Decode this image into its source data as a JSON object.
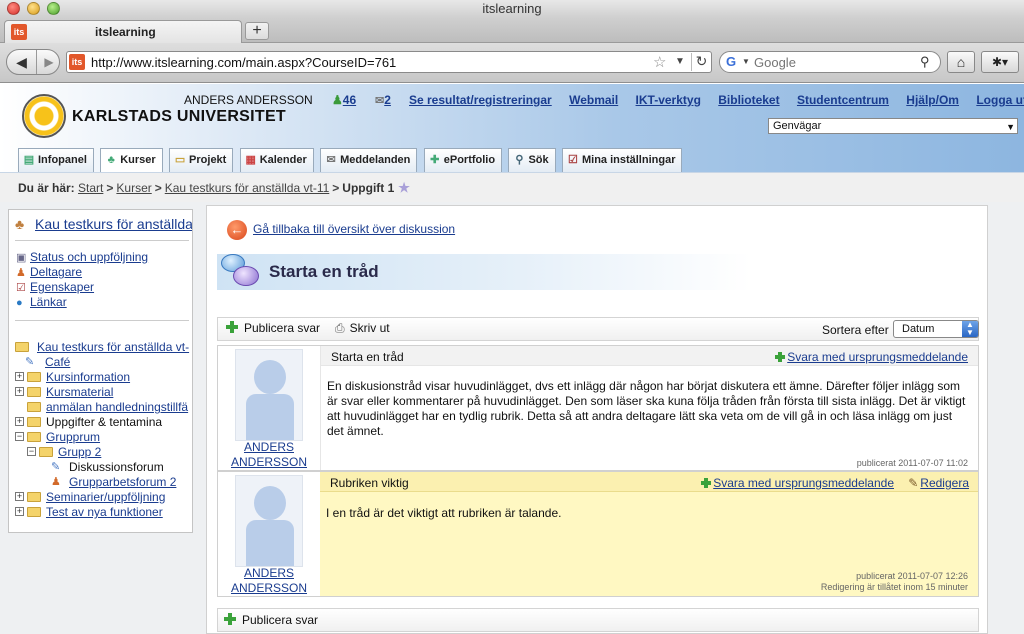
{
  "browser": {
    "window_title": "itslearning",
    "tab_title": "itslearning",
    "favicon_text": "its",
    "new_tab_label": "+",
    "url": "http://www.itslearning.com/main.aspx?CourseID=761",
    "search_placeholder": "Google",
    "icons": [
      "back-arrow-icon",
      "forward-arrow-icon",
      "bookmark-star-icon",
      "reload-icon",
      "search-magnifier-icon",
      "home-icon",
      "bookmarks-icon"
    ]
  },
  "header": {
    "university_name": "KARLSTADS UNIVERSITET",
    "user_name": "ANDERS ANDERSSON",
    "online_count": "46",
    "message_count": "2",
    "links": [
      "Se resultat/registreringar",
      "Webmail",
      "IKT-verktyg",
      "Biblioteket",
      "Studentcentrum",
      "Hjälp/Om",
      "Logga ut"
    ],
    "shortcut_select": "Genvägar"
  },
  "main_tabs": [
    {
      "label": "Infopanel",
      "icon": "infopanel-icon"
    },
    {
      "label": "Kurser",
      "icon": "courses-icon"
    },
    {
      "label": "Projekt",
      "icon": "project-icon"
    },
    {
      "label": "Kalender",
      "icon": "calendar-icon"
    },
    {
      "label": "Meddelanden",
      "icon": "messages-icon"
    },
    {
      "label": "ePortfolio",
      "icon": "eportfolio-icon"
    },
    {
      "label": "Sök",
      "icon": "search-icon"
    },
    {
      "label": "Mina inställningar",
      "icon": "settings-icon"
    }
  ],
  "breadcrumb": {
    "prefix": "Du är här:",
    "items": [
      "Start",
      "Kurser",
      "Kau testkurs för anställda vt-11"
    ],
    "current": "Uppgift 1",
    "separator": ">"
  },
  "sidebar": {
    "course_title": "Kau testkurs för anställda",
    "links": [
      "Status och uppföljning",
      "Deltagare",
      "Egenskaper",
      "Länkar"
    ],
    "tree": [
      {
        "label": "Kau testkurs för anställda vt-",
        "level": 0,
        "type": "folder-open"
      },
      {
        "label": "Café",
        "level": 1,
        "type": "forum"
      },
      {
        "label": "Kursinformation",
        "level": 0,
        "type": "folder-collapsed"
      },
      {
        "label": "Kursmaterial",
        "level": 0,
        "type": "folder-collapsed"
      },
      {
        "label": "anmälan handledningstillfä",
        "level": 1,
        "type": "folder"
      },
      {
        "label": "Uppgifter & tentamina",
        "level": 0,
        "type": "folder-collapsed"
      },
      {
        "label": "Grupprum",
        "level": 0,
        "type": "folder-expanded"
      },
      {
        "label": "Grupp 2",
        "level": 1,
        "type": "folder-expanded"
      },
      {
        "label": "Diskussionsforum",
        "level": 2,
        "type": "forum"
      },
      {
        "label": "Grupparbetsforum 2",
        "level": 2,
        "type": "group-forum"
      },
      {
        "label": "Seminarier/uppföljning",
        "level": 0,
        "type": "folder-collapsed"
      },
      {
        "label": "Test av nya funktioner",
        "level": 0,
        "type": "folder-collapsed"
      }
    ]
  },
  "discussion": {
    "back_link": "Gå tillbaka till översikt över diskussion",
    "heading": "Starta en tråd",
    "toolbar": {
      "publish_reply": "Publicera svar",
      "print": "Skriv ut",
      "sort_label": "Sortera efter",
      "sort_value": "Datum"
    },
    "posts": [
      {
        "subject": "Starta en tråd",
        "author_first": "ANDERS",
        "author_last": "ANDERSSON",
        "reply_label": "Svara med ursprungsmeddelande",
        "text": "En diskusionstråd visar huvudinlägget, dvs ett inlägg där någon har börjat diskutera ett ämne. Därefter följer inlägg som är svar eller kommentarer på huvudinlägget. Den som läser ska kuna följa tråden från första till sista inlägg. Det är viktigt att huvudinlägget har en tydlig rubrik. Detta så att andra deltagare lätt ska veta om de vill gå in och läsa inlägg om just det ämnet.",
        "published": "publicerat 2011-07-07 11:02"
      },
      {
        "subject": "Rubriken viktig",
        "author_first": "ANDERS",
        "author_last": "ANDERSSON",
        "reply_label": "Svara med ursprungsmeddelande",
        "edit_label": "Redigera",
        "text": "I en tråd är det viktigt att rubriken är talande.",
        "published": "publicerat 2011-07-07 12:26",
        "edit_note": "Redigering är tillåtet inom 15 minuter"
      }
    ],
    "bottom_publish_reply": "Publicera svar"
  }
}
